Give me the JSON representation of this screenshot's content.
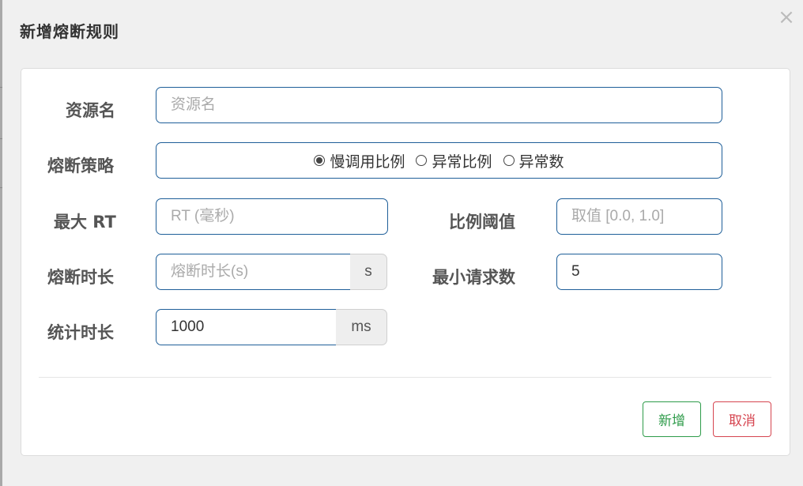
{
  "dialog": {
    "title": "新增熔断规则",
    "close_glyph": "×"
  },
  "form": {
    "resource": {
      "label": "资源名",
      "placeholder": "资源名",
      "value": ""
    },
    "strategy": {
      "label": "熔断策略",
      "options": [
        {
          "label": "慢调用比例",
          "selected": true
        },
        {
          "label": "异常比例",
          "selected": false
        },
        {
          "label": "异常数",
          "selected": false
        }
      ]
    },
    "max_rt": {
      "label": "最大 RT",
      "placeholder": "RT (毫秒)",
      "value": ""
    },
    "ratio_threshold": {
      "label": "比例阈值",
      "placeholder": "取值 [0.0, 1.0]",
      "value": ""
    },
    "time_window": {
      "label": "熔断时长",
      "placeholder": "熔断时长(s)",
      "value": "",
      "unit": "s"
    },
    "min_request": {
      "label": "最小请求数",
      "value": "5"
    },
    "stat_interval": {
      "label": "统计时长",
      "value": "1000",
      "unit": "ms"
    }
  },
  "footer": {
    "add_label": "新增",
    "cancel_label": "取消"
  },
  "colors": {
    "input_border": "#1f5f99",
    "add_button": "#2e9b4a",
    "cancel_button": "#d64550"
  }
}
